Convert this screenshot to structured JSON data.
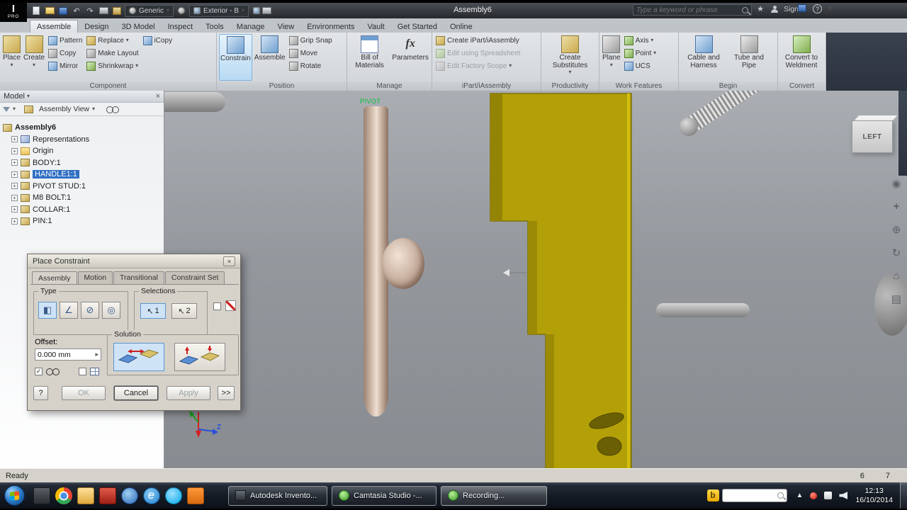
{
  "glyphs": {
    "caret": "▾",
    "close": "×",
    "undo": "↶",
    "redo": "↷",
    "cursor": "↖",
    "check": "✓",
    "plus": "+",
    "question": "?",
    "arrow_right": "▸",
    "chevron_up": "▲",
    "star": "★",
    "ie": "e",
    "fx": "fx",
    "mate": "◧",
    "angle": "∠",
    "tangent": "⊘",
    "insert": "◎",
    "wheel": "◉",
    "pan": "+",
    "zoom": "⊕",
    "orbit": "↻",
    "home": "⌂",
    "list": "▤"
  },
  "colors": {
    "selection_blue": "#2f6fc4",
    "part_yellow": "#b3a008",
    "tool_highlight": "#cfe3f7"
  },
  "titlebar": {
    "logo_i": "I",
    "logo_text": "PRO",
    "material": "Generic",
    "appearance": "Exterior - B",
    "doc_title": "Assembly6",
    "search_placeholder": "Type a keyword or phrase",
    "sign_in": "Sign In"
  },
  "ribbon": {
    "tabs": [
      "Assemble",
      "Design",
      "3D Model",
      "Inspect",
      "Tools",
      "Manage",
      "View",
      "Environments",
      "Vault",
      "Get Started",
      "Online"
    ],
    "component": {
      "label": "Component",
      "place": "Place",
      "create": "Create",
      "pattern": "Pattern",
      "copy": "Copy",
      "mirror": "Mirror",
      "replace": "Replace",
      "make_layout": "Make Layout",
      "shrinkwrap": "Shrinkwrap",
      "icopy": "iCopy"
    },
    "position": {
      "label": "Position",
      "constrain": "Constrain",
      "assemble": "Assemble",
      "grip_snap": "Grip Snap",
      "move": "Move",
      "rotate": "Rotate"
    },
    "manage": {
      "label": "Manage",
      "bom": "Bill of Materials",
      "parameters": "Parameters"
    },
    "ipart": {
      "label": "iPart/iAssembly",
      "create": "Create iPart/iAssembly",
      "edit_spreadsheet": "Edit using Spreadsheet",
      "edit_factory": "Edit Factory Scope"
    },
    "productivity": {
      "label": "Productivity",
      "create_substitutes": "Create Substitutes"
    },
    "work": {
      "label": "Work Features",
      "plane": "Plane",
      "axis": "Axis",
      "point": "Point",
      "ucs": "UCS"
    },
    "begin": {
      "label": "Begin",
      "cable": "Cable and Harness",
      "tube": "Tube and Pipe"
    },
    "convert": {
      "label": "Convert",
      "weldment": "Convert to Weldment"
    }
  },
  "browser": {
    "header": "Model",
    "view_mode": "Assembly View",
    "tree": [
      "Assembly6",
      "Representations",
      "Origin",
      "BODY:1",
      "HANDLE1:1",
      "PIVOT STUD:1",
      "M8 BOLT:1",
      "COLLAR:1",
      "PIN:1"
    ]
  },
  "dialog": {
    "title": "Place Constraint",
    "tabs": [
      "Assembly",
      "Motion",
      "Transitional",
      "Constraint Set"
    ],
    "type_label": "Type",
    "selections_label": "Selections",
    "sel1": "1",
    "sel2": "2",
    "offset_label": "Offset:",
    "offset_value": "0.000 mm",
    "solution_label": "Solution",
    "ok": "OK",
    "cancel": "Cancel",
    "apply": "Apply",
    "more": ">>"
  },
  "viewport": {
    "pivot_label": "PIVOT",
    "viewcube_face": "LEFT",
    "axis_z": "Z"
  },
  "statusbar": {
    "ready": "Ready",
    "n1": "6",
    "n2": "7"
  },
  "taskbar": {
    "win1": "Autodesk Invento...",
    "win2": "Camtasia Studio -...",
    "win3": "Recording...",
    "tray_b": "b",
    "time": "12:13",
    "date": "16/10/2014"
  }
}
